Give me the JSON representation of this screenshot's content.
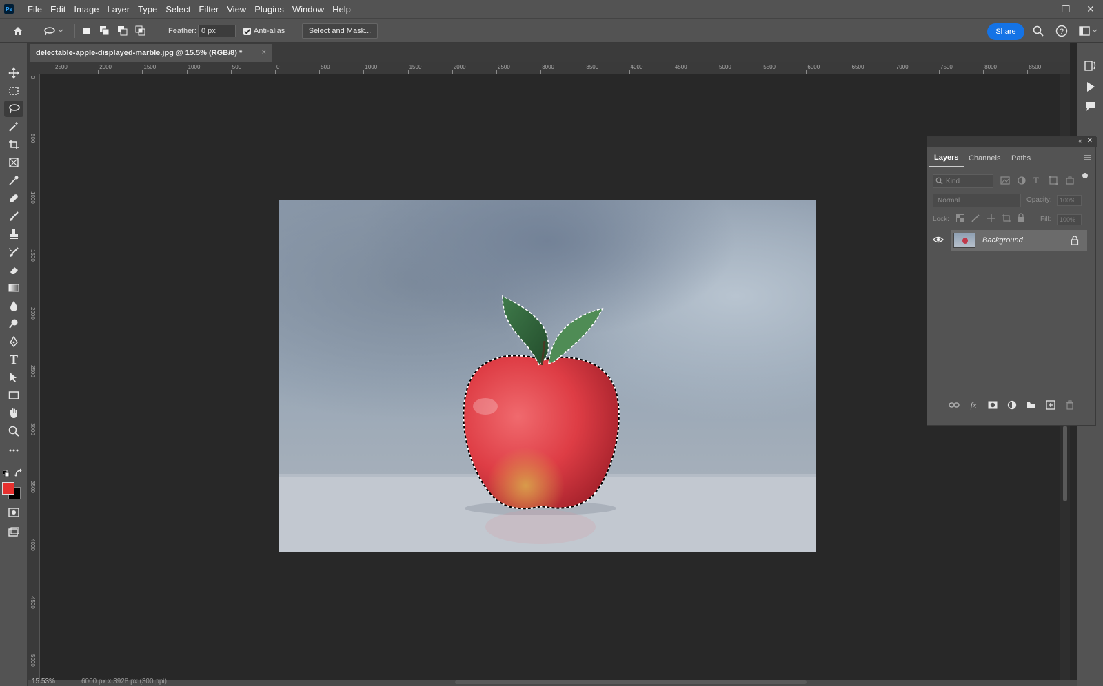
{
  "menu": [
    "File",
    "Edit",
    "Image",
    "Layer",
    "Type",
    "Select",
    "Filter",
    "View",
    "Plugins",
    "Window",
    "Help"
  ],
  "app_logo": "Ps",
  "window_controls": {
    "minimize": "–",
    "restore": "❐",
    "close": "✕"
  },
  "options": {
    "feather_label": "Feather:",
    "feather_value": "0 px",
    "antialias_label": "Anti-alias",
    "antialias_checked": true,
    "select_mask_label": "Select and Mask...",
    "share_label": "Share"
  },
  "document": {
    "tab_title": "delectable-apple-displayed-marble.jpg @ 15.5% (RGB/8) *",
    "tab_close": "×"
  },
  "ruler_top": [
    "2500",
    "2000",
    "1500",
    "1000",
    "500",
    "0",
    "500",
    "1000",
    "1500",
    "2000",
    "2500",
    "3000",
    "3500",
    "4000",
    "4500",
    "5000",
    "5500",
    "6000",
    "6500",
    "7000",
    "7500",
    "8000",
    "8500"
  ],
  "ruler_left": [
    "0",
    "500",
    "1000",
    "1500",
    "2000",
    "2500",
    "3000",
    "3500",
    "4000",
    "4500",
    "5000"
  ],
  "tools": [
    "move-tool",
    "marquee-tool",
    "lasso-tool",
    "magic-wand-tool",
    "crop-tool",
    "frame-tool",
    "eyedropper-tool",
    "healing-brush-tool",
    "brush-tool",
    "clone-stamp-tool",
    "history-brush-tool",
    "eraser-tool",
    "gradient-tool",
    "blur-tool",
    "dodge-tool",
    "pen-tool",
    "type-tool",
    "path-selection-tool",
    "rectangle-tool",
    "hand-tool",
    "zoom-tool",
    "more-tools"
  ],
  "colors": {
    "foreground": "#e8302e",
    "background": "#000000",
    "accent": "#1473e6"
  },
  "layers_panel": {
    "tabs": [
      "Layers",
      "Channels",
      "Paths"
    ],
    "active_tab": "Layers",
    "kind_placeholder": "Kind",
    "blend_mode": "Normal",
    "opacity_label": "Opacity:",
    "opacity_value": "100%",
    "lock_label": "Lock:",
    "fill_label": "Fill:",
    "fill_value": "100%",
    "layers": [
      {
        "name": "Background",
        "visible": true,
        "locked": true
      }
    ]
  },
  "status": {
    "zoom": "15.53%",
    "dimensions": "6000 px x 3928 px (300 ppi)"
  }
}
